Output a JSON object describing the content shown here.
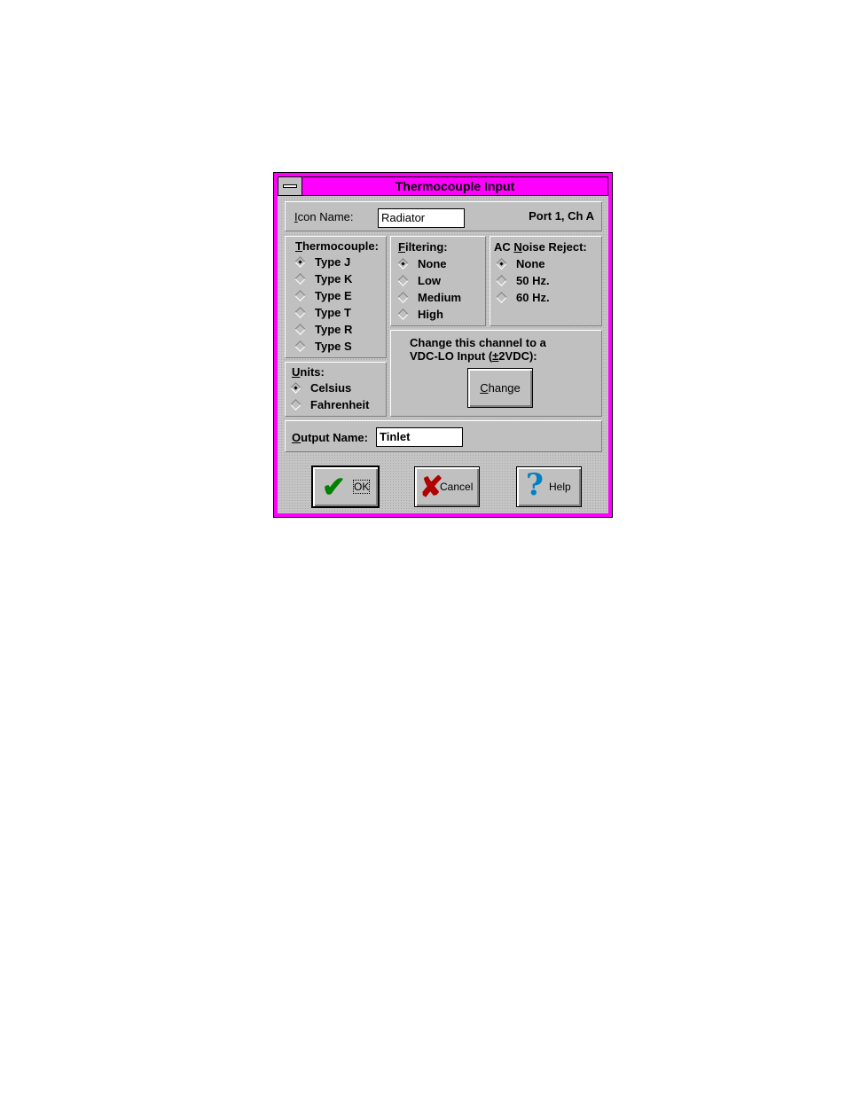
{
  "window": {
    "title": "Thermocouple Input",
    "title_color": "#ff00ff",
    "system_menu_icon": "system-menu-icon"
  },
  "icon_name": {
    "label_prefix": "",
    "label_mnemonic": "I",
    "label_rest": "con Name:",
    "value": "Radiator",
    "port_info": "Port 1, Ch A"
  },
  "thermocouple": {
    "label_mnemonic": "T",
    "label_rest": "hermocouple:",
    "options": [
      {
        "label": "Type J",
        "selected": true
      },
      {
        "label": "Type K",
        "selected": false
      },
      {
        "label": "Type E",
        "selected": false
      },
      {
        "label": "Type T",
        "selected": false
      },
      {
        "label": "Type R",
        "selected": false
      },
      {
        "label": "Type S",
        "selected": false
      }
    ]
  },
  "filtering": {
    "label_mnemonic": "F",
    "label_rest": "iltering:",
    "options": [
      {
        "label": "None",
        "selected": true
      },
      {
        "label": "Low",
        "selected": false
      },
      {
        "label": "Medium",
        "selected": false
      },
      {
        "label": "High",
        "selected": false
      }
    ]
  },
  "noise_reject": {
    "label_prefix": "AC ",
    "label_mnemonic": "N",
    "label_rest": "oise Reject:",
    "options": [
      {
        "label": "None",
        "selected": true
      },
      {
        "label": "50 Hz.",
        "selected": false
      },
      {
        "label": "60 Hz.",
        "selected": false
      }
    ]
  },
  "units": {
    "label_mnemonic": "U",
    "label_rest": "nits:",
    "options": [
      {
        "label": "Celsius",
        "selected": true
      },
      {
        "label": "Fahrenheit",
        "selected": false
      }
    ]
  },
  "change_channel": {
    "line1": "Change this channel to a",
    "line2_prefix": "VDC-LO Input (",
    "line2_mnemonic": "±",
    "line2_rest": "2VDC):",
    "button_mnemonic": "C",
    "button_rest": "hange"
  },
  "output_name": {
    "label_mnemonic": "O",
    "label_rest": "utput Name:",
    "value": "Tinlet"
  },
  "buttons": {
    "ok_label": "OK",
    "ok_icon": "checkmark-icon",
    "ok_icon_color": "#008000",
    "cancel_label": "Cancel",
    "cancel_icon": "x-icon",
    "cancel_icon_color": "#b00000",
    "help_label": "Help",
    "help_icon": "question-mark-icon",
    "help_icon_color": "#0080c0"
  }
}
